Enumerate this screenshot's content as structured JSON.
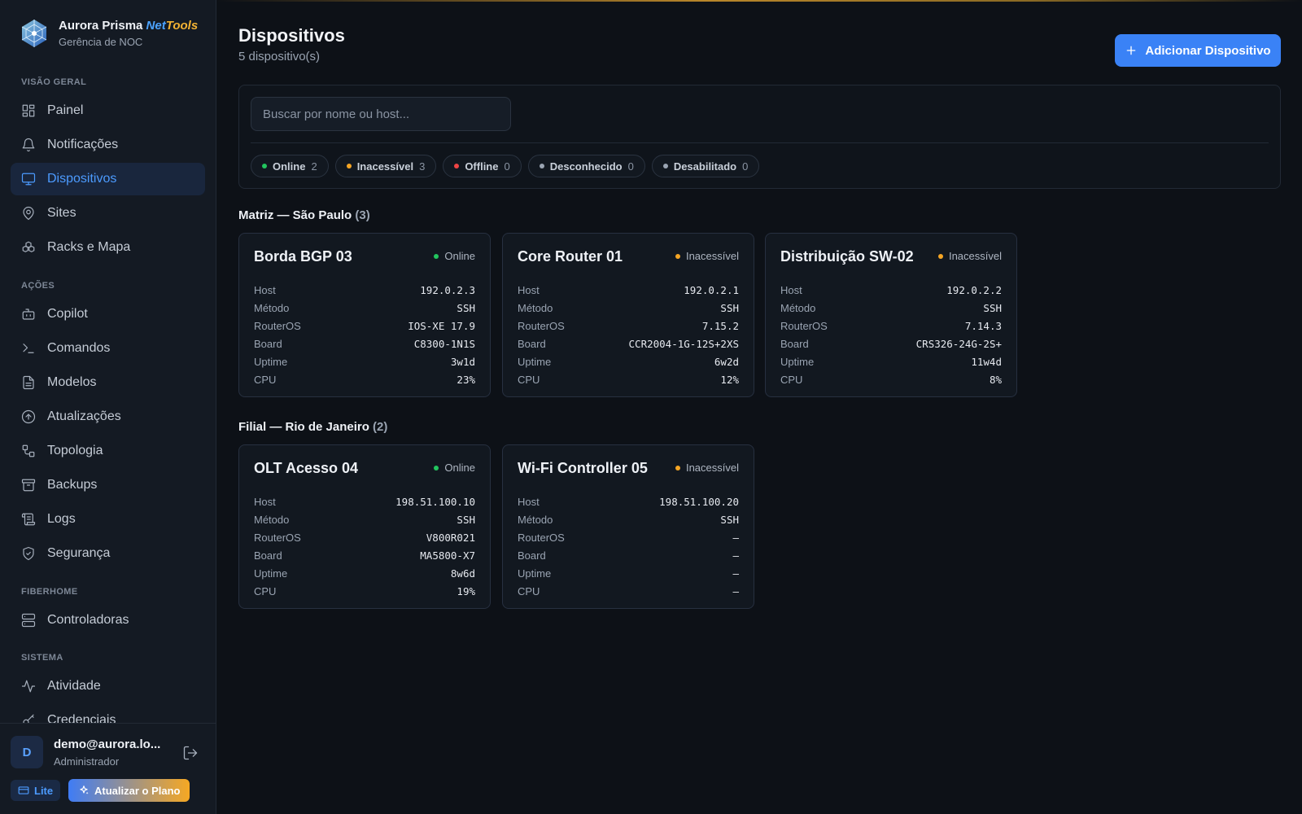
{
  "brand": {
    "name": "Aurora Prisma",
    "name_accent_1": "Net",
    "name_accent_2": "Tools",
    "subtitle": "Gerência de NOC"
  },
  "nav": {
    "sections": [
      {
        "label": "VISÃO GERAL"
      },
      {
        "label": "AÇÕES"
      },
      {
        "label": "FIBERHOME"
      },
      {
        "label": "SISTEMA"
      }
    ],
    "items": [
      {
        "label": "Painel",
        "icon": "grid-icon"
      },
      {
        "label": "Notificações",
        "icon": "bell-icon"
      },
      {
        "label": "Dispositivos",
        "icon": "monitor-icon",
        "active": true
      },
      {
        "label": "Sites",
        "icon": "map-pin-icon"
      },
      {
        "label": "Racks e Mapa",
        "icon": "boxes-icon"
      },
      {
        "label": "Copilot",
        "icon": "bot-icon"
      },
      {
        "label": "Comandos",
        "icon": "terminal-icon"
      },
      {
        "label": "Modelos",
        "icon": "file-text-icon"
      },
      {
        "label": "Atualizações",
        "icon": "arrow-up-circle-icon"
      },
      {
        "label": "Topologia",
        "icon": "topology-icon"
      },
      {
        "label": "Backups",
        "icon": "archive-icon"
      },
      {
        "label": "Logs",
        "icon": "scroll-icon"
      },
      {
        "label": "Segurança",
        "icon": "shield-check-icon"
      },
      {
        "label": "Controladoras",
        "icon": "server-icon"
      },
      {
        "label": "Atividade",
        "icon": "activity-icon"
      },
      {
        "label": "Credenciais",
        "icon": "key-icon"
      }
    ]
  },
  "user": {
    "initial": "D",
    "email": "demo@aurora.lo...",
    "role": "Administrador",
    "plan": "Lite",
    "upgrade_label": "Atualizar o Plano"
  },
  "header": {
    "title": "Dispositivos",
    "subtitle": "5 dispositivo(s)",
    "add_button": "Adicionar Dispositivo"
  },
  "search": {
    "placeholder": "Buscar por nome ou host..."
  },
  "filters": [
    {
      "label": "Online",
      "count": "2",
      "color": "#22c55e"
    },
    {
      "label": "Inacessível",
      "count": "3",
      "color": "#f5a524"
    },
    {
      "label": "Offline",
      "count": "0",
      "color": "#ef4444"
    },
    {
      "label": "Desconhecido",
      "count": "0",
      "color": "#9aa4b2"
    },
    {
      "label": "Desabilitado",
      "count": "0",
      "color": "#9aa4b2"
    }
  ],
  "field_labels": {
    "host": "Host",
    "method": "Método",
    "os": "RouterOS",
    "board": "Board",
    "uptime": "Uptime",
    "cpu": "CPU"
  },
  "groups": [
    {
      "title": "Matriz — São Paulo",
      "count": "(3)",
      "devices": [
        {
          "name": "Borda BGP 03",
          "status": "Online",
          "status_color": "#22c55e",
          "host": "192.0.2.3",
          "method": "SSH",
          "os": "IOS-XE 17.9",
          "board": "C8300-1N1S",
          "uptime": "3w1d",
          "cpu": "23%"
        },
        {
          "name": "Core Router 01",
          "status": "Inacessível",
          "status_color": "#f5a524",
          "host": "192.0.2.1",
          "method": "SSH",
          "os": "7.15.2",
          "board": "CCR2004-1G-12S+2XS",
          "uptime": "6w2d",
          "cpu": "12%"
        },
        {
          "name": "Distribuição SW-02",
          "status": "Inacessível",
          "status_color": "#f5a524",
          "host": "192.0.2.2",
          "method": "SSH",
          "os": "7.14.3",
          "board": "CRS326-24G-2S+",
          "uptime": "11w4d",
          "cpu": "8%"
        }
      ]
    },
    {
      "title": "Filial — Rio de Janeiro",
      "count": "(2)",
      "devices": [
        {
          "name": "OLT Acesso 04",
          "status": "Online",
          "status_color": "#22c55e",
          "host": "198.51.100.10",
          "method": "SSH",
          "os": "V800R021",
          "board": "MA5800-X7",
          "uptime": "8w6d",
          "cpu": "19%"
        },
        {
          "name": "Wi-Fi Controller 05",
          "status": "Inacessível",
          "status_color": "#f5a524",
          "host": "198.51.100.20",
          "method": "SSH",
          "os": "—",
          "board": "—",
          "uptime": "—",
          "cpu": "—"
        }
      ]
    }
  ]
}
